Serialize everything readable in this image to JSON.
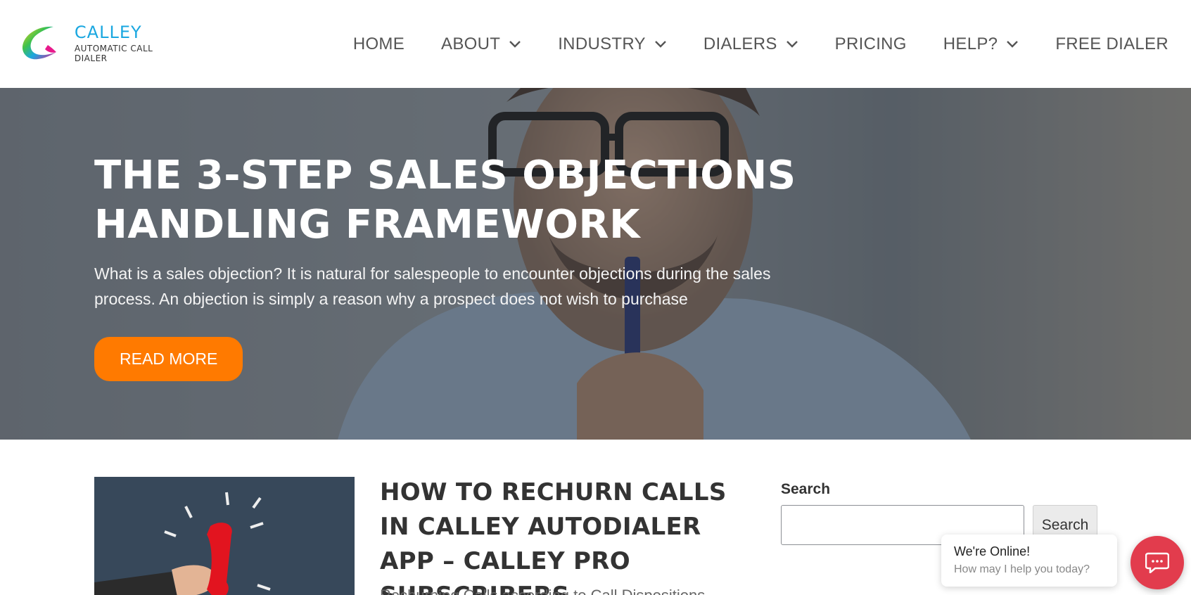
{
  "brand": {
    "name": "CALLEY",
    "tagline": "AUTOMATIC CALL DIALER"
  },
  "nav": {
    "items": [
      {
        "label": "HOME",
        "dropdown": false
      },
      {
        "label": "ABOUT",
        "dropdown": true
      },
      {
        "label": "INDUSTRY",
        "dropdown": true
      },
      {
        "label": "DIALERS",
        "dropdown": true
      },
      {
        "label": "PRICING",
        "dropdown": false
      },
      {
        "label": "HELP?",
        "dropdown": true
      },
      {
        "label": "FREE DIALER",
        "dropdown": false
      }
    ]
  },
  "hero": {
    "title": "THE 3-STEP SALES OBJECTIONS HANDLING FRAMEWORK",
    "excerpt": "What is a sales objection? It is natural for salespeople to encounter objections during the sales process. An objection is simply a reason why a prospect does not wish to purchase",
    "button_label": "READ MORE"
  },
  "post": {
    "title": "HOW TO RECHURN CALLS IN CALLEY AUTODIALER APP – CALLEY PRO SUBSCRIBERS",
    "excerpt": "Rechurning Calls according to Call Dispositions"
  },
  "sidebar": {
    "search_label": "Search",
    "search_placeholder": "",
    "search_button": "Search"
  },
  "chat": {
    "title": "We're Online!",
    "subtitle": "How may I help you today?"
  },
  "colors": {
    "accent": "#ff7a00",
    "brand_blue": "#1aa7e0",
    "chat_red": "#e23c4d"
  }
}
